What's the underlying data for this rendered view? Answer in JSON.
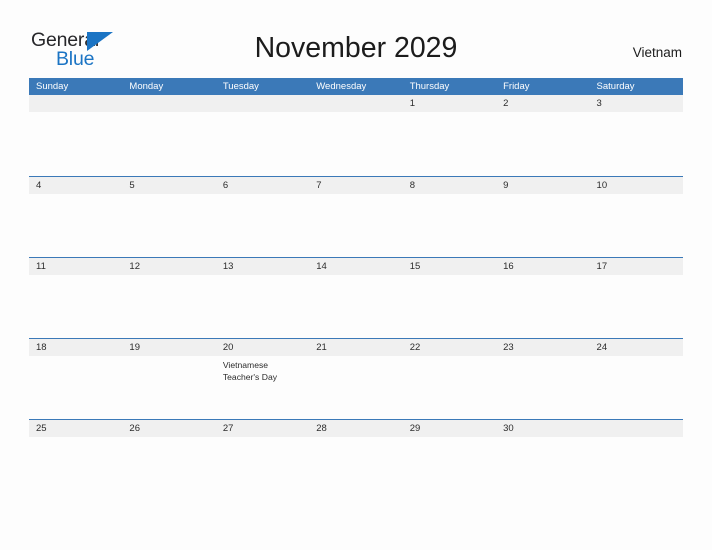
{
  "brand": {
    "name_part1": "General",
    "name_part2": "Blue",
    "flag_icon": "triangle-flag-icon",
    "color_primary": "#1b74c4",
    "color_text": "#27272a"
  },
  "header": {
    "title": "November 2029",
    "region": "Vietnam"
  },
  "theme": {
    "header_blue": "#3b79b8",
    "date_strip_gray": "#f0f0f0",
    "page_background": "#fdfdfd",
    "text_dark": "#2c2c2c"
  },
  "calendar": {
    "month": "November",
    "year": "2029",
    "weekday_headers": [
      "Sunday",
      "Monday",
      "Tuesday",
      "Wednesday",
      "Thursday",
      "Friday",
      "Saturday"
    ],
    "weeks": [
      {
        "days": [
          {
            "date": "",
            "events": []
          },
          {
            "date": "",
            "events": []
          },
          {
            "date": "",
            "events": []
          },
          {
            "date": "",
            "events": []
          },
          {
            "date": "1",
            "events": []
          },
          {
            "date": "2",
            "events": []
          },
          {
            "date": "3",
            "events": []
          }
        ]
      },
      {
        "days": [
          {
            "date": "4",
            "events": []
          },
          {
            "date": "5",
            "events": []
          },
          {
            "date": "6",
            "events": []
          },
          {
            "date": "7",
            "events": []
          },
          {
            "date": "8",
            "events": []
          },
          {
            "date": "9",
            "events": []
          },
          {
            "date": "10",
            "events": []
          }
        ]
      },
      {
        "days": [
          {
            "date": "11",
            "events": []
          },
          {
            "date": "12",
            "events": []
          },
          {
            "date": "13",
            "events": []
          },
          {
            "date": "14",
            "events": []
          },
          {
            "date": "15",
            "events": []
          },
          {
            "date": "16",
            "events": []
          },
          {
            "date": "17",
            "events": []
          }
        ]
      },
      {
        "days": [
          {
            "date": "18",
            "events": []
          },
          {
            "date": "19",
            "events": []
          },
          {
            "date": "20",
            "events": [
              "Vietnamese",
              "Teacher's Day"
            ]
          },
          {
            "date": "21",
            "events": []
          },
          {
            "date": "22",
            "events": []
          },
          {
            "date": "23",
            "events": []
          },
          {
            "date": "24",
            "events": []
          }
        ]
      },
      {
        "days": [
          {
            "date": "25",
            "events": []
          },
          {
            "date": "26",
            "events": []
          },
          {
            "date": "27",
            "events": []
          },
          {
            "date": "28",
            "events": []
          },
          {
            "date": "29",
            "events": []
          },
          {
            "date": "30",
            "events": []
          },
          {
            "date": "",
            "events": []
          }
        ]
      }
    ]
  }
}
